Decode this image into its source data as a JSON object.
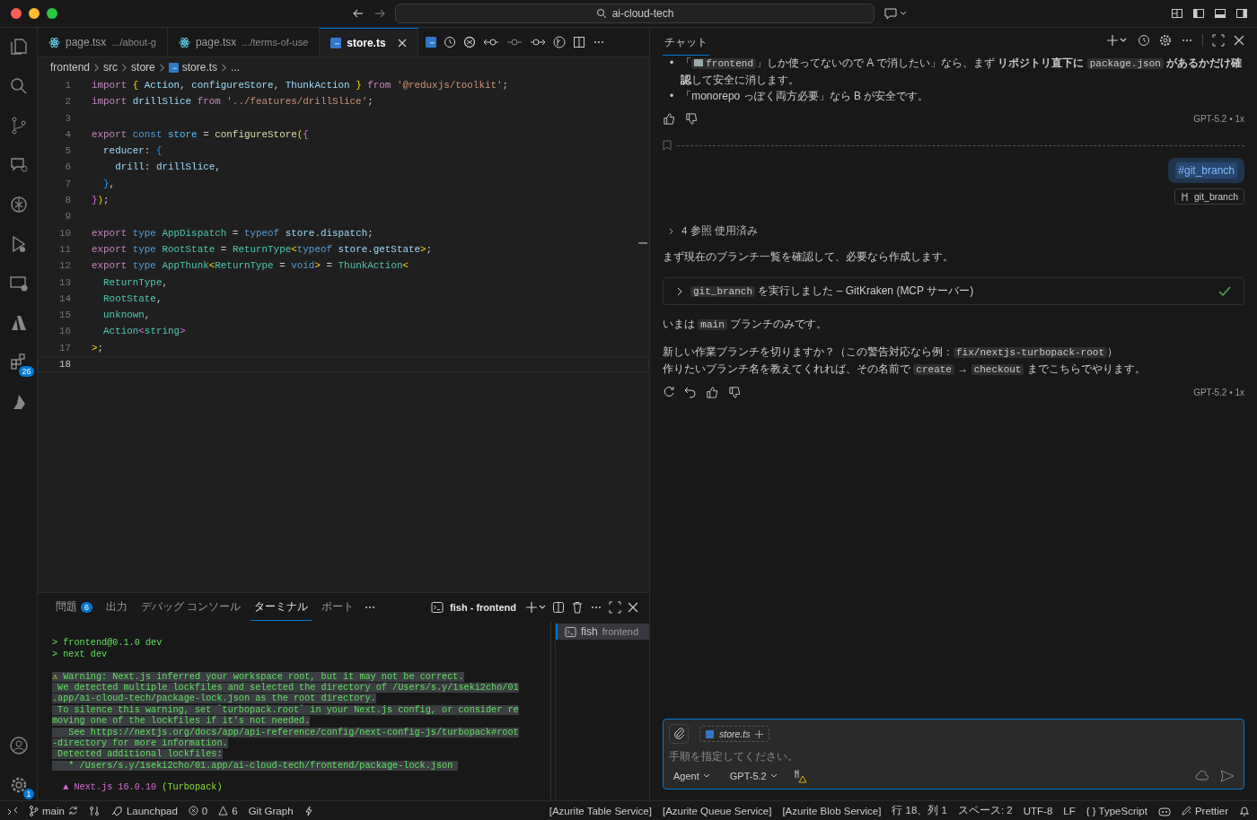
{
  "title_bar": {
    "search": "ai-cloud-tech"
  },
  "activity_bar": {
    "extensions_badge": "26",
    "settings_badge": "1"
  },
  "tabs": [
    {
      "label": "page.tsx",
      "description": ".../about-g",
      "kind": "react",
      "selected": false
    },
    {
      "label": "page.tsx",
      "description": ".../terms-of-use",
      "kind": "react",
      "selected": false
    },
    {
      "label": "store.ts",
      "kind": "ts",
      "selected": true
    }
  ],
  "breadcrumbs": [
    "frontend",
    "src",
    "store",
    "store.ts",
    "..."
  ],
  "code_lines": [
    {
      "number": "1",
      "current": false,
      "tokens": [
        {
          "kind": "ctl",
          "text": "import "
        },
        {
          "kind": "b1",
          "text": "{ "
        },
        {
          "kind": "var",
          "text": "Action"
        },
        {
          "kind": "p",
          "text": ", "
        },
        {
          "kind": "var",
          "text": "configureStore"
        },
        {
          "kind": "p",
          "text": ", "
        },
        {
          "kind": "var",
          "text": "ThunkAction "
        },
        {
          "kind": "b1",
          "text": "} "
        },
        {
          "kind": "ctl",
          "text": "from "
        },
        {
          "kind": "str",
          "text": "'@reduxjs/toolkit'"
        },
        {
          "kind": "p",
          "text": ";"
        }
      ]
    },
    {
      "number": "2",
      "current": false,
      "tokens": [
        {
          "kind": "ctl",
          "text": "import "
        },
        {
          "kind": "var",
          "text": "drillSlice "
        },
        {
          "kind": "ctl",
          "text": "from "
        },
        {
          "kind": "str",
          "text": "'../features/drillSlice'"
        },
        {
          "kind": "p",
          "text": ";"
        }
      ]
    },
    {
      "number": "3",
      "current": false
    },
    {
      "number": "4",
      "current": false,
      "tokens": [
        {
          "kind": "ctl",
          "text": "export "
        },
        {
          "kind": "kw",
          "text": "const "
        },
        {
          "kind": "const",
          "text": "store"
        },
        {
          "kind": "p",
          "text": " = "
        },
        {
          "kind": "fn",
          "text": "configureStore"
        },
        {
          "kind": "b1",
          "text": "("
        },
        {
          "kind": "b2",
          "text": "{"
        }
      ]
    },
    {
      "number": "5",
      "current": false,
      "tokens": [
        {
          "kind": "var",
          "text": "  reducer"
        },
        {
          "kind": "p",
          "text": ": "
        },
        {
          "kind": "b3",
          "text": "{"
        }
      ]
    },
    {
      "number": "6",
      "current": false,
      "tokens": [
        {
          "kind": "var",
          "text": "    drill"
        },
        {
          "kind": "p",
          "text": ": "
        },
        {
          "kind": "var",
          "text": "drillSlice"
        },
        {
          "kind": "p",
          "text": ","
        }
      ]
    },
    {
      "number": "7",
      "current": false,
      "tokens": [
        {
          "kind": "b3",
          "text": "  }"
        },
        {
          "kind": "p",
          "text": ","
        }
      ]
    },
    {
      "number": "8",
      "current": false,
      "tokens": [
        {
          "kind": "b2",
          "text": "}"
        },
        {
          "kind": "b1",
          "text": ")"
        },
        {
          "kind": "p",
          "text": ";"
        }
      ]
    },
    {
      "number": "9",
      "current": false
    },
    {
      "number": "10",
      "current": false,
      "tokens": [
        {
          "kind": "ctl",
          "text": "export "
        },
        {
          "kind": "kw",
          "text": "type "
        },
        {
          "kind": "type",
          "text": "AppDispatch"
        },
        {
          "kind": "p",
          "text": " = "
        },
        {
          "kind": "kw",
          "text": "typeof "
        },
        {
          "kind": "var",
          "text": "store"
        },
        {
          "kind": "p",
          "text": "."
        },
        {
          "kind": "var",
          "text": "dispatch"
        },
        {
          "kind": "p",
          "text": ";"
        }
      ]
    },
    {
      "number": "11",
      "current": false,
      "tokens": [
        {
          "kind": "ctl",
          "text": "export "
        },
        {
          "kind": "kw",
          "text": "type "
        },
        {
          "kind": "type",
          "text": "RootState"
        },
        {
          "kind": "p",
          "text": " = "
        },
        {
          "kind": "type",
          "text": "ReturnType"
        },
        {
          "kind": "b1",
          "text": "<"
        },
        {
          "kind": "kw",
          "text": "typeof "
        },
        {
          "kind": "var",
          "text": "store"
        },
        {
          "kind": "p",
          "text": "."
        },
        {
          "kind": "var",
          "text": "getState"
        },
        {
          "kind": "b1",
          "text": ">"
        },
        {
          "kind": "p",
          "text": ";"
        }
      ]
    },
    {
      "number": "12",
      "current": false,
      "tokens": [
        {
          "kind": "ctl",
          "text": "export "
        },
        {
          "kind": "kw",
          "text": "type "
        },
        {
          "kind": "type",
          "text": "AppThunk"
        },
        {
          "kind": "b1",
          "text": "<"
        },
        {
          "kind": "type",
          "text": "ReturnType"
        },
        {
          "kind": "p",
          "text": " = "
        },
        {
          "kind": "kw",
          "text": "void"
        },
        {
          "kind": "b1",
          "text": ">"
        },
        {
          "kind": "p",
          "text": " = "
        },
        {
          "kind": "type",
          "text": "ThunkAction"
        },
        {
          "kind": "b1",
          "text": "<"
        }
      ]
    },
    {
      "number": "13",
      "current": false,
      "tokens": [
        {
          "kind": "type",
          "text": "  ReturnType"
        },
        {
          "kind": "p",
          "text": ","
        }
      ]
    },
    {
      "number": "14",
      "current": false,
      "tokens": [
        {
          "kind": "type",
          "text": "  RootState"
        },
        {
          "kind": "p",
          "text": ","
        }
      ]
    },
    {
      "number": "15",
      "current": false,
      "tokens": [
        {
          "kind": "type",
          "text": "  unknown"
        },
        {
          "kind": "p",
          "text": ","
        }
      ]
    },
    {
      "number": "16",
      "current": false,
      "tokens": [
        {
          "kind": "type",
          "text": "  Action"
        },
        {
          "kind": "b2",
          "text": "<"
        },
        {
          "kind": "type",
          "text": "string"
        },
        {
          "kind": "b2",
          "text": ">"
        }
      ]
    },
    {
      "number": "17",
      "current": false,
      "tokens": [
        {
          "kind": "b1",
          "text": ">"
        },
        {
          "kind": "p",
          "text": ";"
        }
      ]
    },
    {
      "number": "18",
      "current": true
    }
  ],
  "panel": {
    "tabs": [
      {
        "label": "問題",
        "badge": "6",
        "selected": false
      },
      {
        "label": "出力",
        "selected": false
      },
      {
        "label": "デバッグ コンソール",
        "selected": false
      },
      {
        "label": "ターミナル",
        "selected": true
      },
      {
        "label": "ポート",
        "selected": false
      }
    ],
    "terminal_title": "fish - frontend",
    "terminal_list": [
      {
        "name": "fish",
        "detail": "frontend",
        "selected": true
      }
    ],
    "terminal_lines": [
      {
        "kind": "blank"
      },
      {
        "kind": "prompt",
        "text": "> frontend@0.1.0 dev"
      },
      {
        "kind": "prompt",
        "text": "> next dev"
      },
      {
        "kind": "blank"
      },
      {
        "kind": "warning",
        "mark": "⚠",
        "text": " Warning: Next.js inferred your workspace root, but it may not be correct.",
        "selected": true
      },
      {
        "kind": "output",
        "text": " We detected multiple lockfiles and selected the directory of /Users/s.y/1seki2cho/01",
        "selected": true
      },
      {
        "kind": "output",
        "text": ".app/ai-cloud-tech/package-lock.json as the root directory.",
        "selected": true
      },
      {
        "kind": "output",
        "text": " To silence this warning, set `turbopack.root` in your Next.js config, or consider re",
        "selected": true
      },
      {
        "kind": "output",
        "text": "moving one of the lockfiles if it's not needed.",
        "selected": true
      },
      {
        "kind": "output",
        "text": "   See https://nextjs.org/docs/app/api-reference/config/next-config-js/turbopack#root",
        "selected": true
      },
      {
        "kind": "output",
        "text": "-directory for more information.",
        "selected": true
      },
      {
        "kind": "output",
        "text": " Detected additional lockfiles:",
        "selected": true
      },
      {
        "kind": "output",
        "text": "   * /Users/s.y/1seki2cho/01.app/ai-cloud-tech/frontend/package-lock.json ",
        "selected": true
      },
      {
        "kind": "blank"
      },
      {
        "kind": "banner",
        "text": "  ▲ Next.js 16.0.10",
        "note": " (Turbopack)"
      }
    ]
  },
  "chat": {
    "title": "チャット",
    "bullets": [
      {
        "marker": "•",
        "segments": [
          {
            "kind": "text",
            "text": "「"
          },
          {
            "kind": "folder",
            "text": "frontend"
          },
          {
            "kind": "text",
            "text": "」しか使ってないので A で消したい」なら、まず **リポジトリ直下に** "
          },
          {
            "kind": "code",
            "text": "package.json"
          },
          {
            "kind": "text",
            "text": " **があるかだけ確認**して安全に消します。"
          }
        ]
      },
      {
        "marker": "•",
        "segments": [
          {
            "kind": "text",
            "text": "「monorepo っぽく両方必要」なら B が安全です。"
          }
        ]
      }
    ],
    "first_model": "GPT-5.2 • 1x",
    "user_message": "#git_branch",
    "user_reference": "git_branch",
    "references": {
      "text": "4 参照 使用済み",
      "expanded": false
    },
    "intro": "まず現在のブランチ一覧を確認して、必要なら作成します。",
    "tool_call": {
      "segments": [
        {
          "kind": "code",
          "text": "git_branch"
        },
        {
          "kind": "text",
          "text": " を実行しました – GitKraken (MCP サーバー)"
        }
      ],
      "done": true
    },
    "paragraphs": [
      [
        {
          "kind": "text",
          "text": "いまは "
        },
        {
          "kind": "code",
          "text": "main"
        },
        {
          "kind": "text",
          "text": " ブランチのみです。"
        }
      ],
      [
        {
          "kind": "text",
          "text": "新しい作業ブランチを切りますか？（この警告対応なら例："
        },
        {
          "kind": "code",
          "text": "fix/nextjs-turbopack-root"
        },
        {
          "kind": "text",
          "text": "）"
        },
        {
          "kind": "break"
        },
        {
          "kind": "text",
          "text": "作りたいブランチ名を教えてくれれば、その名前で "
        },
        {
          "kind": "code",
          "text": "create"
        },
        {
          "kind": "text",
          "text": " → "
        },
        {
          "kind": "code",
          "text": "checkout"
        },
        {
          "kind": "text",
          "text": " までこちらでやります。"
        }
      ]
    ],
    "last_model": "GPT-5.2 • 1x",
    "input": {
      "attachment": "store.ts",
      "placeholder": "手順を指定してください。",
      "mode": "Agent",
      "model": "GPT-5.2"
    }
  },
  "status_bar": {
    "left": [
      {
        "kind": "branch",
        "text": "main"
      },
      {
        "kind": "launchpad",
        "text": "Launchpad"
      },
      {
        "kind": "errors",
        "text": "0"
      },
      {
        "kind": "warnings",
        "text": "6"
      },
      {
        "kind": "plain",
        "text": "Git Graph"
      }
    ],
    "right": [
      "[Azurite Table Service]",
      "[Azurite Queue Service]",
      "[Azurite Blob Service]",
      "行 18、列 1",
      "スペース: 2",
      "UTF-8",
      "LF",
      "{ } TypeScript",
      "Prettier"
    ]
  }
}
